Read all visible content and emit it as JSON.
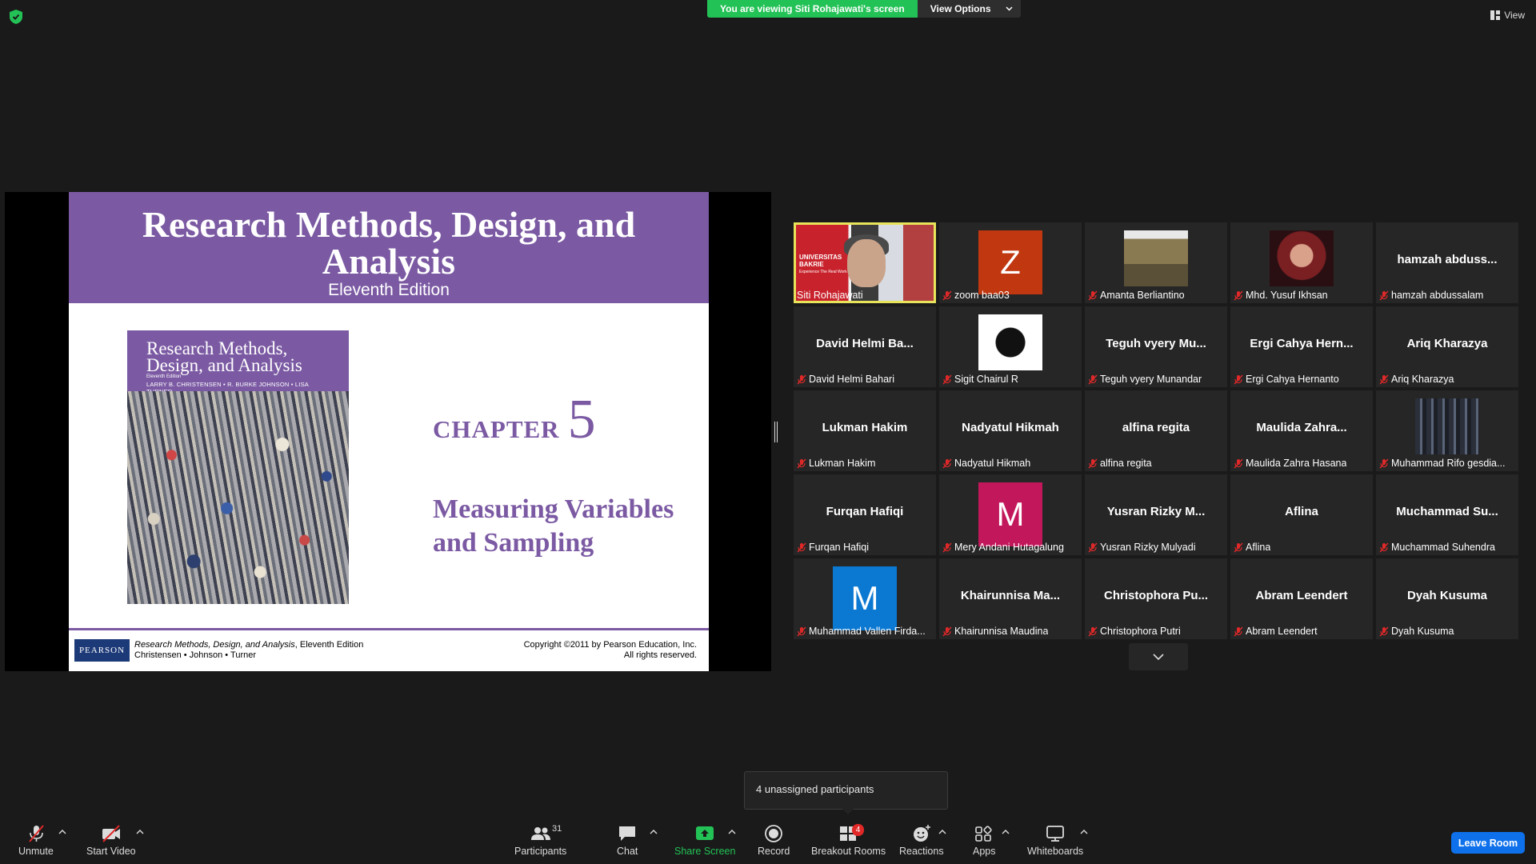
{
  "banner": {
    "viewing": "You are viewing Siti Rohajawati's screen",
    "view_options": "View Options"
  },
  "view_button": "View",
  "slide": {
    "title": "Research Methods, Design, and Analysis",
    "edition": "Eleventh Edition",
    "book": {
      "title_line1": "Research Methods,",
      "title_line2": "Design, and Analysis",
      "edition": "Eleventh Edition",
      "authors": "LARRY B. CHRISTENSEN • R. BURKE JOHNSON • LISA TURNER"
    },
    "chapter_word": "CHAPTER",
    "chapter_num": "5",
    "chapter_title_line1": "Measuring Variables",
    "chapter_title_line2": "and Sampling",
    "publisher_logo": "PEARSON",
    "footer_left_italic": "Research Methods, Design, and Analysis",
    "footer_left_edition": ", Eleventh Edition",
    "footer_left_line2": "Christensen • Johnson • Turner",
    "footer_right_line1": "Copyright ©2011 by Pearson Education, Inc.",
    "footer_right_line2": "All rights reserved."
  },
  "participants": [
    {
      "label": "Siti Rohajawati",
      "type": "video",
      "muted": false,
      "active": true,
      "video_text1": "UNIVERSITAS",
      "video_text2": "BAKRIE",
      "video_text3": "Experience The Real Work"
    },
    {
      "label": "zoom baa03",
      "type": "avatar",
      "initial": "Z",
      "color": "#c1370f",
      "muted": true
    },
    {
      "label": "Amanta Berliantino",
      "type": "photo",
      "photo": "person-photo",
      "muted": true
    },
    {
      "label": "Mhd. Yusuf Ikhsan",
      "type": "photo",
      "photo": "character-photo",
      "muted": true
    },
    {
      "label": "hamzah abdussalam",
      "type": "name",
      "name": "hamzah abduss...",
      "muted": true
    },
    {
      "label": "David Helmi Bahari",
      "type": "name",
      "name": "David Helmi Ba...",
      "muted": true
    },
    {
      "label": "Sigit Chairul R",
      "type": "photo",
      "photo": "samurai-photo",
      "muted": true
    },
    {
      "label": "Teguh vyery Munandar",
      "type": "name",
      "name": "Teguh vyery Mu...",
      "muted": true
    },
    {
      "label": "Ergi Cahya Hernanto",
      "type": "name",
      "name": "Ergi Cahya Hern...",
      "muted": true
    },
    {
      "label": "Ariq Kharazya",
      "type": "name",
      "name": "Ariq Kharazya",
      "muted": true
    },
    {
      "label": "Lukman Hakim",
      "type": "name",
      "name": "Lukman Hakim",
      "muted": true
    },
    {
      "label": "Nadyatul Hikmah",
      "type": "name",
      "name": "Nadyatul Hikmah",
      "muted": true
    },
    {
      "label": "alfina regita",
      "type": "name",
      "name": "alfina regita",
      "muted": true
    },
    {
      "label": "Maulida Zahra Hasana",
      "type": "name",
      "name": "Maulida Zahra...",
      "muted": true
    },
    {
      "label": "Muhammad Rifo gesdia...",
      "type": "photo",
      "photo": "city-photo",
      "muted": true
    },
    {
      "label": "Furqan Hafiqi",
      "type": "name",
      "name": "Furqan Hafiqi",
      "muted": true
    },
    {
      "label": "Mery Andani Hutagalung",
      "type": "avatar",
      "initial": "M",
      "color": "#c2185b",
      "muted": true
    },
    {
      "label": "Yusran Rizky Mulyadi",
      "type": "name",
      "name": "Yusran Rizky M...",
      "muted": true
    },
    {
      "label": "Aflina",
      "type": "name",
      "name": "Aflina",
      "muted": true
    },
    {
      "label": "Muchammad Suhendra",
      "type": "name",
      "name": "Muchammad Su...",
      "muted": true
    },
    {
      "label": "Muhammad Vallen Firda...",
      "type": "avatar",
      "initial": "M",
      "color": "#0b78d1",
      "muted": true
    },
    {
      "label": "Khairunnisa Maudina",
      "type": "name",
      "name": "Khairunnisa Ma...",
      "muted": true
    },
    {
      "label": "Christophora Putri",
      "type": "name",
      "name": "Christophora Pu...",
      "muted": true
    },
    {
      "label": "Abram Leendert",
      "type": "name",
      "name": "Abram Leendert",
      "muted": true
    },
    {
      "label": "Dyah Kusuma",
      "type": "name",
      "name": "Dyah Kusuma",
      "muted": true
    }
  ],
  "tooltip": "4 unassigned participants",
  "toolbar": {
    "unmute": "Unmute",
    "start_video": "Start Video",
    "participants": "Participants",
    "participants_count": "31",
    "chat": "Chat",
    "share_screen": "Share Screen",
    "record": "Record",
    "breakout_rooms": "Breakout Rooms",
    "breakout_badge": "4",
    "reactions": "Reactions",
    "apps": "Apps",
    "whiteboards": "Whiteboards",
    "leave": "Leave Room"
  },
  "colors": {
    "accent_purple": "#7b5aa3",
    "zoom_green": "#23c256",
    "leave_blue": "#0e71eb",
    "active_speaker": "#e7e35a"
  }
}
